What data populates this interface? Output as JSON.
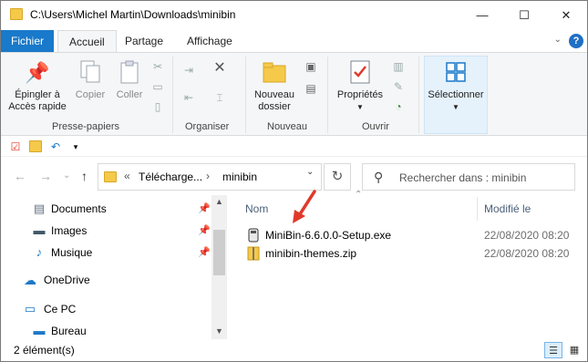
{
  "window": {
    "title": "C:\\Users\\Michel Martin\\Downloads\\minibin",
    "minimize": "—",
    "maximize": "☐",
    "close": "✕"
  },
  "ribbon_tabs": {
    "file": "Fichier",
    "home": "Accueil",
    "share": "Partage",
    "view": "Affichage",
    "help": "?"
  },
  "ribbon": {
    "pin_label": "Épingler à\nAccès rapide",
    "pin_line1": "Épingler à",
    "pin_line2": "Accès rapide",
    "copy": "Copier",
    "paste": "Coller",
    "group_clipboard": "Presse-papiers",
    "group_organize": "Organiser",
    "new_folder_line1": "Nouveau",
    "new_folder_line2": "dossier",
    "group_new": "Nouveau",
    "properties": "Propriétés",
    "group_open": "Ouvrir",
    "select": "Sélectionner"
  },
  "address": {
    "segment1": "Télécharge...",
    "segment2": "minibin",
    "overflow": "«"
  },
  "search": {
    "placeholder": "Rechercher dans : minibin"
  },
  "nav_pane": {
    "items": [
      {
        "label": "Documents",
        "icon": "document-icon"
      },
      {
        "label": "Images",
        "icon": "image-icon"
      },
      {
        "label": "Musique",
        "icon": "music-icon"
      },
      {
        "label": "OneDrive",
        "icon": "cloud-icon"
      },
      {
        "label": "Ce PC",
        "icon": "computer-icon"
      },
      {
        "label": "Bureau",
        "icon": "desktop-icon"
      }
    ]
  },
  "columns": {
    "name": "Nom",
    "modified": "Modifié le"
  },
  "files": [
    {
      "name": "MiniBin-6.6.0.0-Setup.exe",
      "date": "22/08/2020 08:20",
      "icon": "installer-icon"
    },
    {
      "name": "minibin-themes.zip",
      "date": "22/08/2020 08:20",
      "icon": "zip-icon"
    }
  ],
  "status": {
    "count": "2 élément(s)"
  },
  "colors": {
    "accent": "#1979ca",
    "arrow": "#e0392b"
  }
}
